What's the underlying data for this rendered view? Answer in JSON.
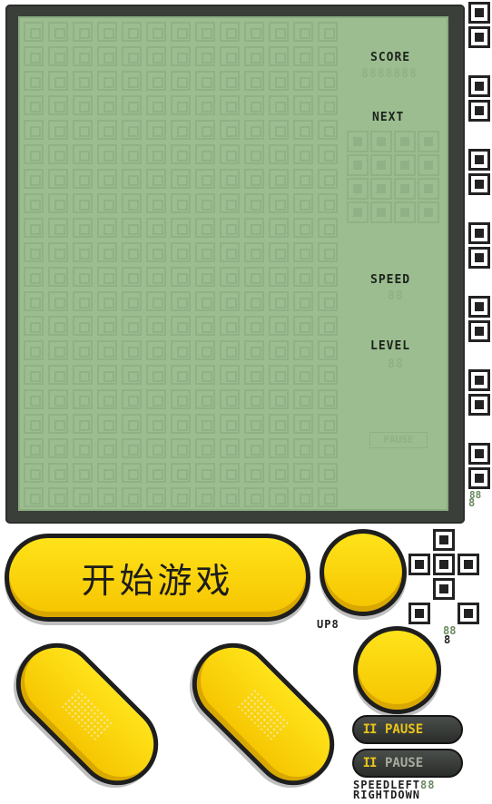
{
  "screen": {
    "labels": {
      "score": "SCORE",
      "next": "NEXT",
      "speed": "SPEED",
      "level": "LEVEL"
    },
    "score_digits": "8888888",
    "speed_digits": "88",
    "level_digits": "88",
    "pause_indicator": "PAUSE"
  },
  "controls": {
    "start_label": "开始游戏",
    "up_label": "UP",
    "up_digit": "8",
    "pause_icon": "II",
    "pause_label": "PAUSE",
    "pause_label_2": "PAUSE",
    "speed_label": "SPEED",
    "left_label": "LEFT",
    "right_label": "RIGHT",
    "down_label": "DOWN",
    "side_digits_top": "88",
    "side_digit_small": "8",
    "mid_digits": "88",
    "mid_digit_small": "8",
    "bottom_digits": "88"
  },
  "colors": {
    "lcd": "#9bbd90",
    "lcd_ghost": "#8fb185",
    "button_yellow": "#ffd600",
    "frame": "#3b3f3a"
  }
}
